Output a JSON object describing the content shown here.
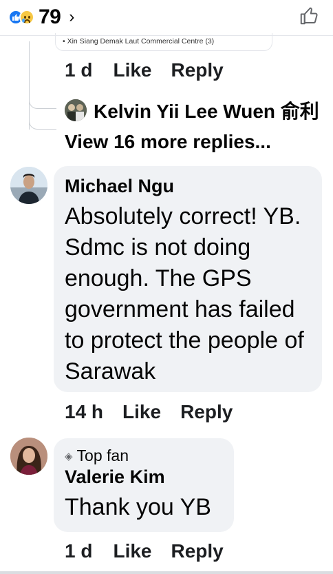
{
  "header": {
    "reactions": [
      "like-icon",
      "sad-icon"
    ],
    "reaction_count": "79",
    "chevron": "›",
    "colors": {
      "like": "#1877f2",
      "sad": "#f7c845"
    }
  },
  "previous_comment": {
    "tail_text": "• Xin Siang Demak Laut Commercial Centre (3)",
    "time": "1 d",
    "like_label": "Like",
    "reply_label": "Reply",
    "reply_preview_name": "Kelvin Yii Lee Wuen 俞利",
    "view_more_label": "View 16 more replies..."
  },
  "comments": [
    {
      "author": "Michael Ngu",
      "body": "Absolutely correct! YB. Sdmc is not doing enough. The GPS government has failed to protect the people of Sarawak",
      "time": "14 h",
      "like_label": "Like",
      "reply_label": "Reply"
    },
    {
      "badge": "Top fan",
      "author": "Valerie Kim",
      "body": "Thank you YB",
      "time": "1 d",
      "like_label": "Like",
      "reply_label": "Reply"
    }
  ]
}
